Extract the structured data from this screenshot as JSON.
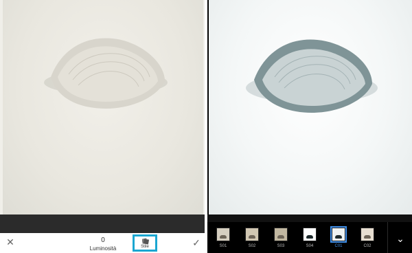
{
  "left": {
    "cancel_icon": "close-icon",
    "confirm_icon": "check-icon",
    "brightness": {
      "value": "0",
      "label": "Luminosità"
    },
    "style_button": {
      "label": "Stile",
      "icon": "style-icon",
      "accent": "#1aa6d1"
    }
  },
  "right": {
    "presets": [
      {
        "name": "S01",
        "tone": "#d6cfc0",
        "selected": false
      },
      {
        "name": "S02",
        "tone": "#d1c7b2",
        "selected": false
      },
      {
        "name": "S03",
        "tone": "#c2b8a1",
        "selected": false
      },
      {
        "name": "S04",
        "tone": "#ffffff",
        "selected": false
      },
      {
        "name": "C01",
        "tone": "#eef2f2",
        "selected": true
      },
      {
        "name": "C02",
        "tone": "#e7ded0",
        "selected": false
      }
    ],
    "expand_icon": "chevron-down-icon",
    "accent": "#3f8ee8"
  }
}
